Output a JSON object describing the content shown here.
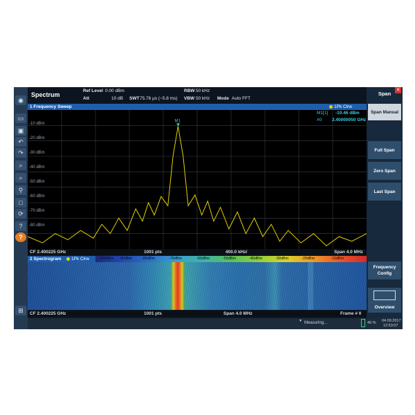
{
  "app": {
    "title": "Spectrum"
  },
  "header": {
    "ref_level_label": "Ref Level",
    "ref_level_value": "0.00 dBm",
    "att_label": "Att",
    "att_value": "10 dB",
    "swt_label": "SWT",
    "swt_value": "75.76 µs (~5.8 ms)",
    "rbw_label": "RBW",
    "rbw_value": "50 kHz",
    "vbw_label": "VBW",
    "vbw_value": "50 kHz",
    "mode_label": "Mode",
    "mode_value": "Auto FFT"
  },
  "sweep_window": {
    "title": "1 Frequency Sweep",
    "trace_label": "1Pk Clrw",
    "marker": {
      "name": "M1",
      "label": "M1[1]",
      "level": "-10.46 dBm",
      "index_label": "#0",
      "frequency": "2.40000050 GHz"
    },
    "y_labels": [
      "-10 dBm",
      "-20 dBm",
      "-30 dBm",
      "-40 dBm",
      "-50 dBm",
      "-60 dBm",
      "-70 dBm",
      "-80 dBm"
    ],
    "footer": {
      "cf": "CF 2.400225 GHz",
      "pts": "1001 pts",
      "div": "400.0 kHz/",
      "span": "Span 4.0 MHz"
    }
  },
  "spectrogram_window": {
    "title": "2 Spectrogram",
    "trace_label": "1Pk Clrw",
    "color_scale": [
      "-100dBm",
      "-90dBm",
      "-80dBm",
      "-70dBm",
      "-60dBm",
      "-50dBm",
      "-40dBm",
      "-30dBm",
      "-20dBm",
      "-10dBm"
    ],
    "footer": {
      "cf": "CF 2.400225 GHz",
      "pts": "1001 pts",
      "span": "Span 4.0 MHz",
      "frame": "Frame # 0"
    }
  },
  "panel": {
    "title": "Span",
    "softkeys": [
      "Span Manual",
      "Full Span",
      "Zero Span",
      "Last Span"
    ],
    "frequency_config": "Frequency Config",
    "overview": "Overview"
  },
  "status": {
    "measuring": "Measuring...",
    "battery": "49 %",
    "date": "04.09.2017",
    "time": "12:53:07"
  },
  "colors": {
    "trace": "#e6d400",
    "window_title_bar": "#1f5eab",
    "marker_text": "#39d0e6"
  },
  "chart_data": {
    "type": "line",
    "xlabel": "",
    "ylabel": "",
    "x_range_mhz": [
      2398.225,
      2402.225
    ],
    "ylim": [
      -90,
      0
    ],
    "series": [
      {
        "name": "1Pk Clrw",
        "x": [
          2398.225,
          2398.4,
          2398.55,
          2398.7,
          2398.85,
          2399.0,
          2399.1,
          2399.2,
          2399.3,
          2399.4,
          2399.5,
          2399.58,
          2399.65,
          2399.72,
          2399.8,
          2399.88,
          2399.94,
          2400.0,
          2400.06,
          2400.12,
          2400.2,
          2400.28,
          2400.35,
          2400.42,
          2400.5,
          2400.6,
          2400.7,
          2400.8,
          2400.9,
          2401.0,
          2401.1,
          2401.2,
          2401.3,
          2401.45,
          2401.6,
          2401.75,
          2401.9,
          2402.05,
          2402.225
        ],
        "y": [
          -82,
          -86,
          -80,
          -84,
          -78,
          -83,
          -74,
          -80,
          -70,
          -78,
          -64,
          -72,
          -60,
          -68,
          -56,
          -62,
          -30,
          -10.46,
          -30,
          -62,
          -55,
          -68,
          -59,
          -72,
          -63,
          -77,
          -66,
          -80,
          -70,
          -82,
          -74,
          -85,
          -78,
          -86,
          -80,
          -88,
          -82,
          -85,
          -80
        ]
      }
    ],
    "marker": {
      "x": 2400.0005,
      "y": -10.46
    }
  }
}
